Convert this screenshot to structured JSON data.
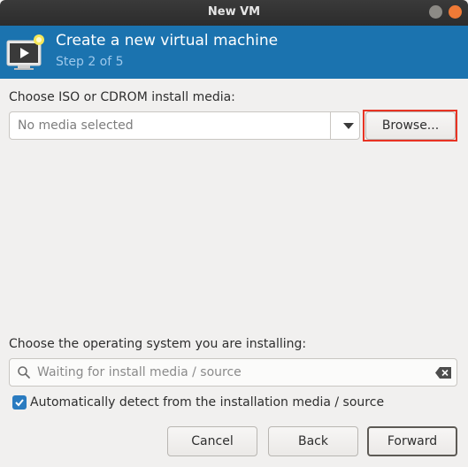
{
  "window": {
    "title": "New VM"
  },
  "header": {
    "title": "Create a new virtual machine",
    "step": "Step 2 of 5"
  },
  "install_media": {
    "label": "Choose ISO or CDROM install media:",
    "combo_value": "No media selected",
    "browse_label": "Browse..."
  },
  "os": {
    "label": "Choose the operating system you are installing:",
    "search_placeholder": "Waiting for install media / source",
    "auto_detect_label": "Automatically detect from the installation media / source",
    "auto_detect_checked": true
  },
  "buttons": {
    "cancel": "Cancel",
    "back": "Back",
    "forward": "Forward"
  },
  "colors": {
    "header_bg": "#1b73af",
    "highlight": "#e83323",
    "checkbox": "#2a7bc0"
  }
}
